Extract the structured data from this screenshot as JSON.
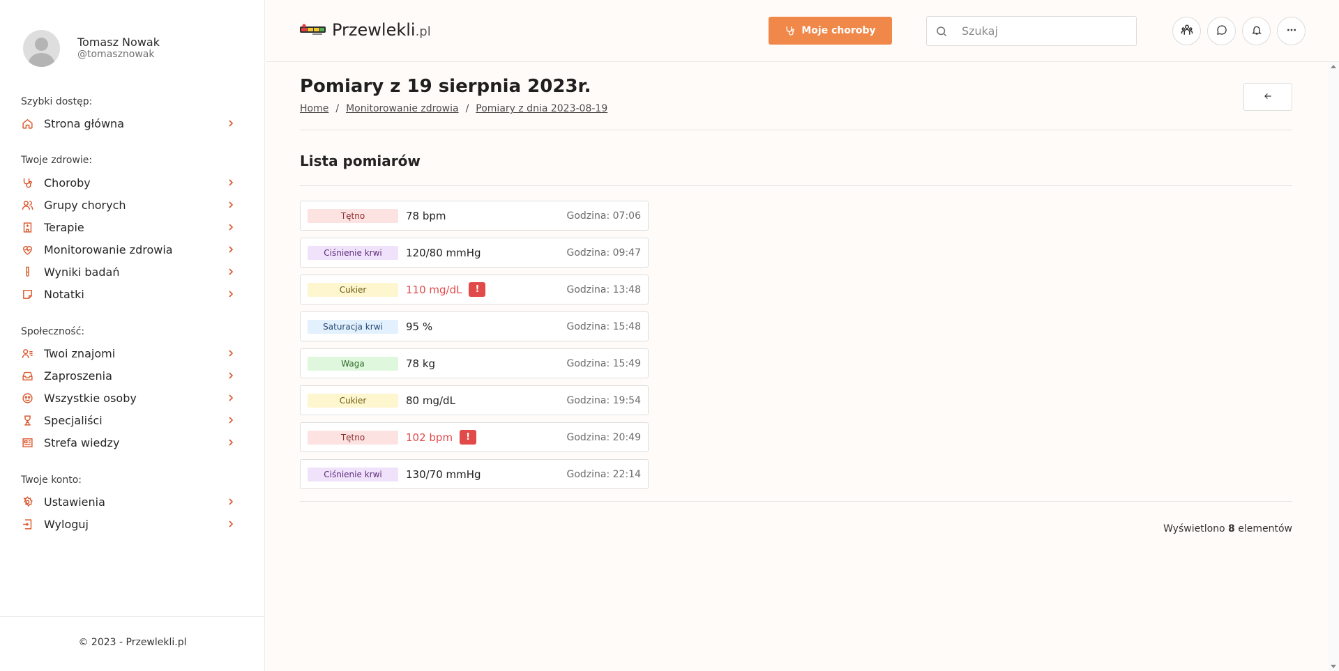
{
  "user": {
    "name": "Tomasz Nowak",
    "handle": "@tomasznowak"
  },
  "sidebar": {
    "sections": [
      {
        "title": "Szybki dostęp:",
        "items": [
          {
            "label": "Strona główna",
            "icon": "home-icon"
          }
        ]
      },
      {
        "title": "Twoje zdrowie:",
        "items": [
          {
            "label": "Choroby",
            "icon": "stethoscope-icon"
          },
          {
            "label": "Grupy chorych",
            "icon": "users-icon"
          },
          {
            "label": "Terapie",
            "icon": "hospital-icon"
          },
          {
            "label": "Monitorowanie zdrowia",
            "icon": "heart-pulse-icon"
          },
          {
            "label": "Wyniki badań",
            "icon": "test-tube-icon"
          },
          {
            "label": "Notatki",
            "icon": "note-icon"
          }
        ]
      },
      {
        "title": "Społeczność:",
        "items": [
          {
            "label": "Twoi znajomi",
            "icon": "user-list-icon"
          },
          {
            "label": "Zaproszenia",
            "icon": "inbox-icon"
          },
          {
            "label": "Wszystkie osoby",
            "icon": "people-icon"
          },
          {
            "label": "Specjaliści",
            "icon": "doctor-icon"
          },
          {
            "label": "Strefa wiedzy",
            "icon": "newspaper-icon"
          }
        ]
      },
      {
        "title": "Twoje konto:",
        "items": [
          {
            "label": "Ustawienia",
            "icon": "gear-icon"
          },
          {
            "label": "Wyloguj",
            "icon": "logout-icon"
          }
        ]
      }
    ],
    "copyright": "© 2023 - Przewlekli.pl"
  },
  "header": {
    "logo_main": "Przewlekli",
    "logo_suffix": ".pl",
    "primary_button": "Moje choroby",
    "search_placeholder": "Szukaj"
  },
  "page": {
    "title": "Pomiary z 19 sierpnia 2023r.",
    "breadcrumb": [
      "Home",
      "Monitorowanie zdrowia",
      "Pomiary z dnia 2023-08-19"
    ],
    "list_title": "Lista pomiarów"
  },
  "measurements": [
    {
      "type": "Tętno",
      "value": "78 bpm",
      "time": "Godzina: 07:06",
      "alert": false,
      "color": "#fde2e2"
    },
    {
      "type": "Ciśnienie krwi",
      "value": "120/80 mmHg",
      "time": "Godzina: 09:47",
      "alert": false,
      "color": "#f1e2fb"
    },
    {
      "type": "Cukier",
      "value": "110 mg/dL",
      "time": "Godzina: 13:48",
      "alert": true,
      "color": "#fdf6cf"
    },
    {
      "type": "Saturacja krwi",
      "value": "95 %",
      "time": "Godzina: 15:48",
      "alert": false,
      "color": "#e3f0fd"
    },
    {
      "type": "Waga",
      "value": "78 kg",
      "time": "Godzina: 15:49",
      "alert": false,
      "color": "#dff8dd"
    },
    {
      "type": "Cukier",
      "value": "80 mg/dL",
      "time": "Godzina: 19:54",
      "alert": false,
      "color": "#fdf6cf"
    },
    {
      "type": "Tętno",
      "value": "102 bpm",
      "time": "Godzina: 20:49",
      "alert": true,
      "color": "#fde2e2"
    },
    {
      "type": "Ciśnienie krwi",
      "value": "130/70 mmHg",
      "time": "Godzina: 22:14",
      "alert": false,
      "color": "#f1e2fb"
    }
  ],
  "alert_symbol": "!",
  "footer": {
    "prefix": "Wyświetlono",
    "count": "8",
    "suffix": "elementów"
  },
  "colors": {
    "accent": "#f0884a",
    "alert": "#e24a4a",
    "icon": "#d9572b"
  }
}
